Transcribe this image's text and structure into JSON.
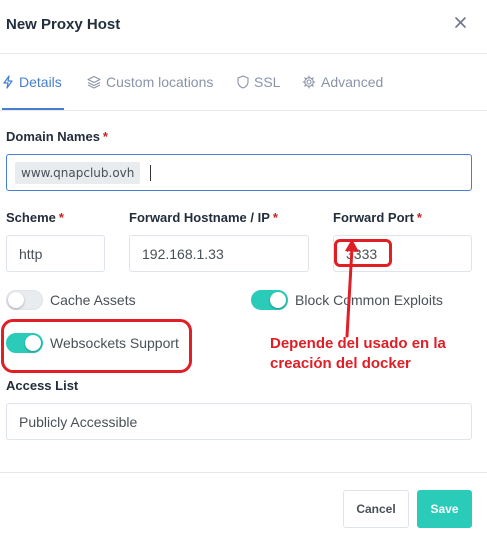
{
  "modal": {
    "title": "New Proxy Host"
  },
  "tabs": [
    {
      "label": "Details",
      "icon": "bolt-icon",
      "active": true
    },
    {
      "label": "Custom locations",
      "icon": "layers-icon",
      "active": false
    },
    {
      "label": "SSL",
      "icon": "shield-icon",
      "active": false
    },
    {
      "label": "Advanced",
      "icon": "gear-icon",
      "active": false
    }
  ],
  "form": {
    "domain_names": {
      "label": "Domain Names",
      "required_mark": "*",
      "values": [
        "www.qnapclub.ovh"
      ]
    },
    "scheme": {
      "label": "Scheme",
      "required_mark": "*",
      "value": "http"
    },
    "forward_host": {
      "label": "Forward Hostname / IP",
      "required_mark": "*",
      "value": "192.168.1.33"
    },
    "forward_port": {
      "label": "Forward Port",
      "required_mark": "*",
      "value": "3333"
    },
    "cache_assets": {
      "label": "Cache Assets",
      "enabled": false
    },
    "block_exploits": {
      "label": "Block Common Exploits",
      "enabled": true
    },
    "websockets": {
      "label": "Websockets Support",
      "enabled": true
    },
    "access_list": {
      "label": "Access List",
      "value": "Publicly Accessible"
    }
  },
  "annotation": {
    "line1": "Depende del usado en la",
    "line2": "creación del docker",
    "color": "#e01e26"
  },
  "footer": {
    "cancel_label": "Cancel",
    "save_label": "Save"
  },
  "colors": {
    "accent": "#467fcf",
    "toggle_on": "#2bcbba",
    "save_button": "#2bcbba"
  }
}
